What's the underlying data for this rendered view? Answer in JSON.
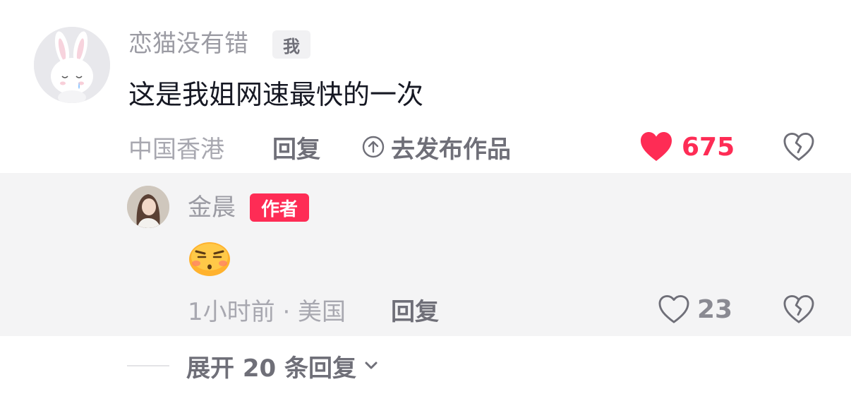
{
  "comment": {
    "username": "恋猫没有错",
    "me_tag": "我",
    "text": "这是我姐网速最快的一次",
    "location": "中国香港",
    "reply_label": "回复",
    "publish_label": "去发布作品",
    "like_count": "675",
    "liked": true
  },
  "reply": {
    "username": "金晨",
    "author_tag": "作者",
    "emoji": "smirk-emoji",
    "time_location": "1小时前 · 美国",
    "reply_label": "回复",
    "like_count": "23",
    "liked": false
  },
  "expand": {
    "label": "展开 20 条回复"
  },
  "colors": {
    "accent": "#fe2c55",
    "meta_gray": "#a8a8b0",
    "text_dark": "#161823",
    "reply_bg": "#f4f4f5"
  }
}
